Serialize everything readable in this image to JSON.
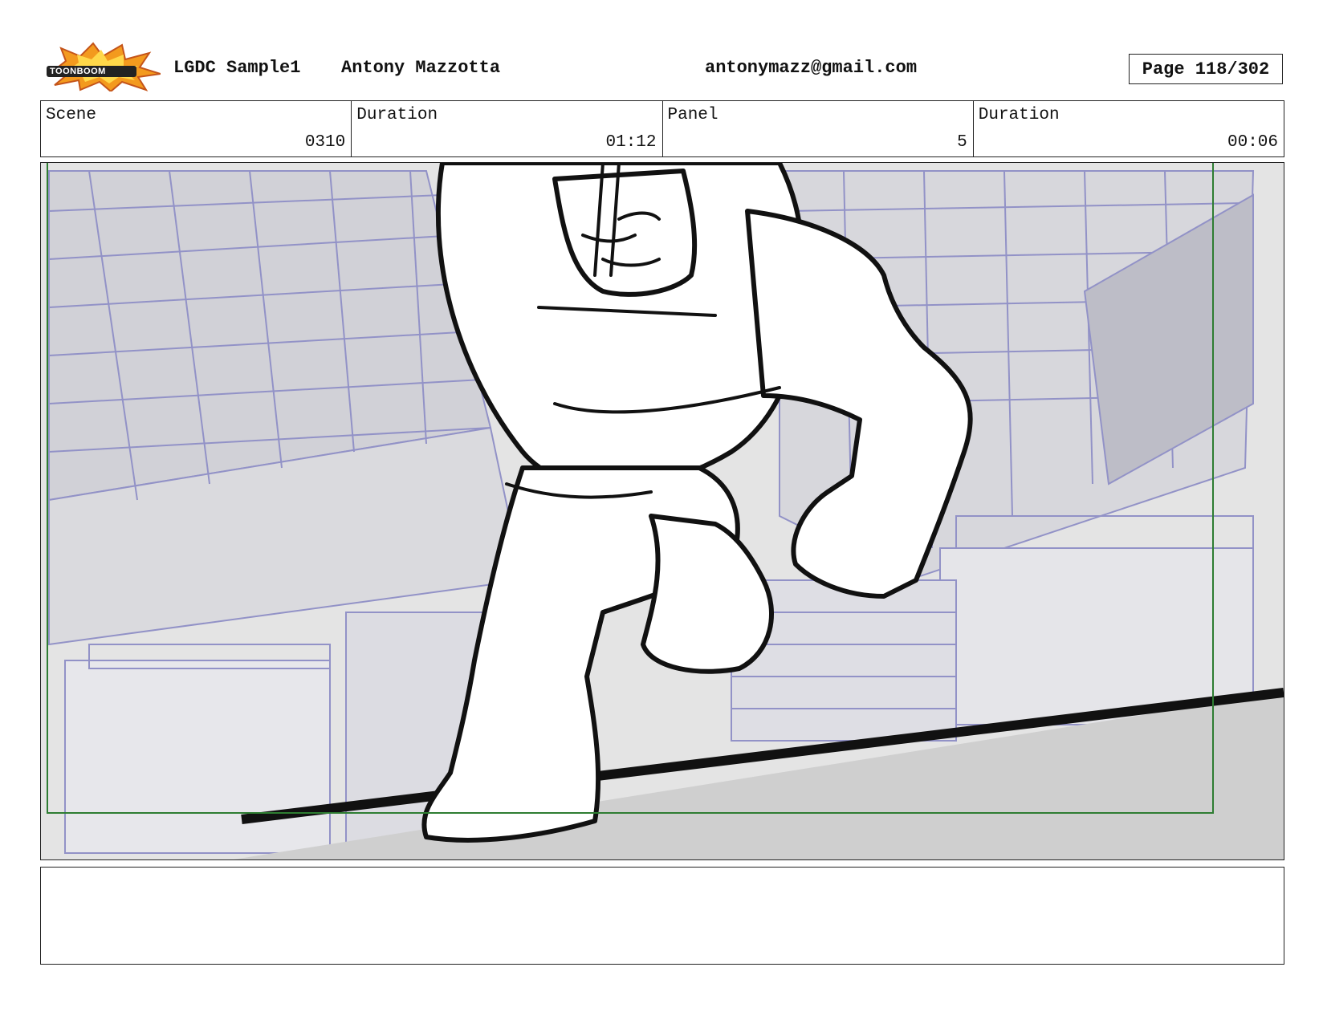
{
  "header": {
    "logo_text": "TOONBOOM",
    "project": "LGDC Sample1",
    "author": "Antony Mazzotta",
    "email": "antonymazz@gmail.com",
    "page": "Page 118/302"
  },
  "info": {
    "scene_label": "Scene",
    "scene_value": "0310",
    "scene_duration_label": "Duration",
    "scene_duration_value": "01:12",
    "panel_label": "Panel",
    "panel_value": "5",
    "panel_duration_label": "Duration",
    "panel_duration_value": "00:06"
  },
  "panel_image": {
    "subject": "storyboard-sketch",
    "colors": {
      "background": "#e4e4e4",
      "line_art": "#4a4a8a",
      "safe_frame": "#2e7d32",
      "ink": "#111111"
    }
  },
  "notes": {
    "text": ""
  }
}
